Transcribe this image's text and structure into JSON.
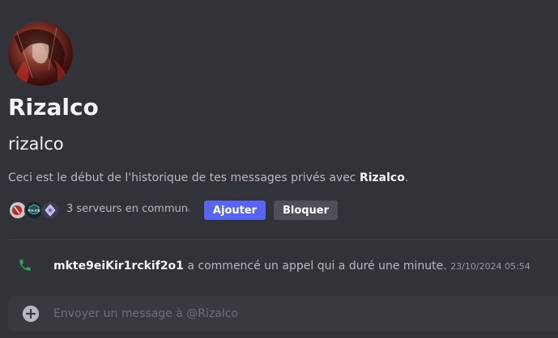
{
  "profile": {
    "display_name": "Rizalco",
    "username": "rizalco",
    "intro_prefix": "Ceci est le début de l'historique de tes messages privés avec ",
    "intro_name": "Rizalco",
    "intro_suffix": "."
  },
  "mutual": {
    "text": "3 serveurs en commun",
    "servers": [
      {
        "icon": "server-icon-red-avatar"
      },
      {
        "icon": "server-icon-police-logo",
        "label": "POLICE"
      },
      {
        "icon": "server-icon-diamond"
      }
    ]
  },
  "actions": {
    "add_label": "Ajouter",
    "block_label": "Bloquer"
  },
  "call": {
    "icon": "phone-icon",
    "user": "mkte9eiKir1rckif2o1",
    "description": " a commencé un appel qui a duré une minute. ",
    "timestamp": "23/10/2024 05:54"
  },
  "composer": {
    "placeholder": "Envoyer un message à @Rizalco",
    "value": ""
  },
  "colors": {
    "background": "#313338",
    "accent": "#5865f2",
    "call_green": "#23a55a"
  }
}
